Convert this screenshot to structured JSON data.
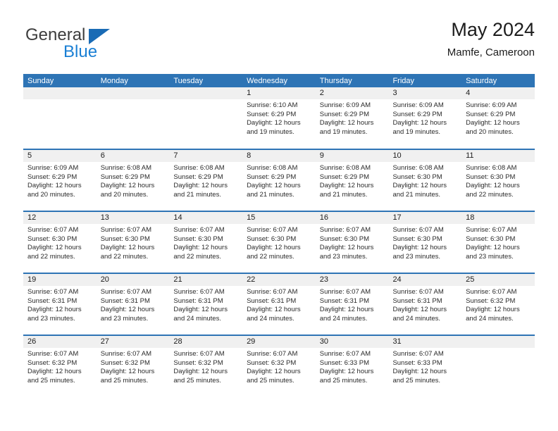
{
  "brand": {
    "name_part1": "General",
    "name_part2": "Blue",
    "triangle_color": "#1a6bb5",
    "blue_color": "#1a7fd4"
  },
  "header": {
    "title": "May 2024",
    "subtitle": "Mamfe, Cameroon"
  },
  "theme": {
    "header_band": "#2e74b5",
    "daynum_band": "#f0f0f0",
    "text": "#1c1c1c"
  },
  "weekday_headers": [
    "Sunday",
    "Monday",
    "Tuesday",
    "Wednesday",
    "Thursday",
    "Friday",
    "Saturday"
  ],
  "weeks": [
    [
      {
        "day": "",
        "lines": []
      },
      {
        "day": "",
        "lines": []
      },
      {
        "day": "",
        "lines": []
      },
      {
        "day": "1",
        "lines": [
          "Sunrise: 6:10 AM",
          "Sunset: 6:29 PM",
          "Daylight: 12 hours",
          "and 19 minutes."
        ]
      },
      {
        "day": "2",
        "lines": [
          "Sunrise: 6:09 AM",
          "Sunset: 6:29 PM",
          "Daylight: 12 hours",
          "and 19 minutes."
        ]
      },
      {
        "day": "3",
        "lines": [
          "Sunrise: 6:09 AM",
          "Sunset: 6:29 PM",
          "Daylight: 12 hours",
          "and 19 minutes."
        ]
      },
      {
        "day": "4",
        "lines": [
          "Sunrise: 6:09 AM",
          "Sunset: 6:29 PM",
          "Daylight: 12 hours",
          "and 20 minutes."
        ]
      }
    ],
    [
      {
        "day": "5",
        "lines": [
          "Sunrise: 6:09 AM",
          "Sunset: 6:29 PM",
          "Daylight: 12 hours",
          "and 20 minutes."
        ]
      },
      {
        "day": "6",
        "lines": [
          "Sunrise: 6:08 AM",
          "Sunset: 6:29 PM",
          "Daylight: 12 hours",
          "and 20 minutes."
        ]
      },
      {
        "day": "7",
        "lines": [
          "Sunrise: 6:08 AM",
          "Sunset: 6:29 PM",
          "Daylight: 12 hours",
          "and 21 minutes."
        ]
      },
      {
        "day": "8",
        "lines": [
          "Sunrise: 6:08 AM",
          "Sunset: 6:29 PM",
          "Daylight: 12 hours",
          "and 21 minutes."
        ]
      },
      {
        "day": "9",
        "lines": [
          "Sunrise: 6:08 AM",
          "Sunset: 6:29 PM",
          "Daylight: 12 hours",
          "and 21 minutes."
        ]
      },
      {
        "day": "10",
        "lines": [
          "Sunrise: 6:08 AM",
          "Sunset: 6:30 PM",
          "Daylight: 12 hours",
          "and 21 minutes."
        ]
      },
      {
        "day": "11",
        "lines": [
          "Sunrise: 6:08 AM",
          "Sunset: 6:30 PM",
          "Daylight: 12 hours",
          "and 22 minutes."
        ]
      }
    ],
    [
      {
        "day": "12",
        "lines": [
          "Sunrise: 6:07 AM",
          "Sunset: 6:30 PM",
          "Daylight: 12 hours",
          "and 22 minutes."
        ]
      },
      {
        "day": "13",
        "lines": [
          "Sunrise: 6:07 AM",
          "Sunset: 6:30 PM",
          "Daylight: 12 hours",
          "and 22 minutes."
        ]
      },
      {
        "day": "14",
        "lines": [
          "Sunrise: 6:07 AM",
          "Sunset: 6:30 PM",
          "Daylight: 12 hours",
          "and 22 minutes."
        ]
      },
      {
        "day": "15",
        "lines": [
          "Sunrise: 6:07 AM",
          "Sunset: 6:30 PM",
          "Daylight: 12 hours",
          "and 22 minutes."
        ]
      },
      {
        "day": "16",
        "lines": [
          "Sunrise: 6:07 AM",
          "Sunset: 6:30 PM",
          "Daylight: 12 hours",
          "and 23 minutes."
        ]
      },
      {
        "day": "17",
        "lines": [
          "Sunrise: 6:07 AM",
          "Sunset: 6:30 PM",
          "Daylight: 12 hours",
          "and 23 minutes."
        ]
      },
      {
        "day": "18",
        "lines": [
          "Sunrise: 6:07 AM",
          "Sunset: 6:30 PM",
          "Daylight: 12 hours",
          "and 23 minutes."
        ]
      }
    ],
    [
      {
        "day": "19",
        "lines": [
          "Sunrise: 6:07 AM",
          "Sunset: 6:31 PM",
          "Daylight: 12 hours",
          "and 23 minutes."
        ]
      },
      {
        "day": "20",
        "lines": [
          "Sunrise: 6:07 AM",
          "Sunset: 6:31 PM",
          "Daylight: 12 hours",
          "and 23 minutes."
        ]
      },
      {
        "day": "21",
        "lines": [
          "Sunrise: 6:07 AM",
          "Sunset: 6:31 PM",
          "Daylight: 12 hours",
          "and 24 minutes."
        ]
      },
      {
        "day": "22",
        "lines": [
          "Sunrise: 6:07 AM",
          "Sunset: 6:31 PM",
          "Daylight: 12 hours",
          "and 24 minutes."
        ]
      },
      {
        "day": "23",
        "lines": [
          "Sunrise: 6:07 AM",
          "Sunset: 6:31 PM",
          "Daylight: 12 hours",
          "and 24 minutes."
        ]
      },
      {
        "day": "24",
        "lines": [
          "Sunrise: 6:07 AM",
          "Sunset: 6:31 PM",
          "Daylight: 12 hours",
          "and 24 minutes."
        ]
      },
      {
        "day": "25",
        "lines": [
          "Sunrise: 6:07 AM",
          "Sunset: 6:32 PM",
          "Daylight: 12 hours",
          "and 24 minutes."
        ]
      }
    ],
    [
      {
        "day": "26",
        "lines": [
          "Sunrise: 6:07 AM",
          "Sunset: 6:32 PM",
          "Daylight: 12 hours",
          "and 25 minutes."
        ]
      },
      {
        "day": "27",
        "lines": [
          "Sunrise: 6:07 AM",
          "Sunset: 6:32 PM",
          "Daylight: 12 hours",
          "and 25 minutes."
        ]
      },
      {
        "day": "28",
        "lines": [
          "Sunrise: 6:07 AM",
          "Sunset: 6:32 PM",
          "Daylight: 12 hours",
          "and 25 minutes."
        ]
      },
      {
        "day": "29",
        "lines": [
          "Sunrise: 6:07 AM",
          "Sunset: 6:32 PM",
          "Daylight: 12 hours",
          "and 25 minutes."
        ]
      },
      {
        "day": "30",
        "lines": [
          "Sunrise: 6:07 AM",
          "Sunset: 6:33 PM",
          "Daylight: 12 hours",
          "and 25 minutes."
        ]
      },
      {
        "day": "31",
        "lines": [
          "Sunrise: 6:07 AM",
          "Sunset: 6:33 PM",
          "Daylight: 12 hours",
          "and 25 minutes."
        ]
      },
      {
        "day": "",
        "lines": []
      }
    ]
  ]
}
